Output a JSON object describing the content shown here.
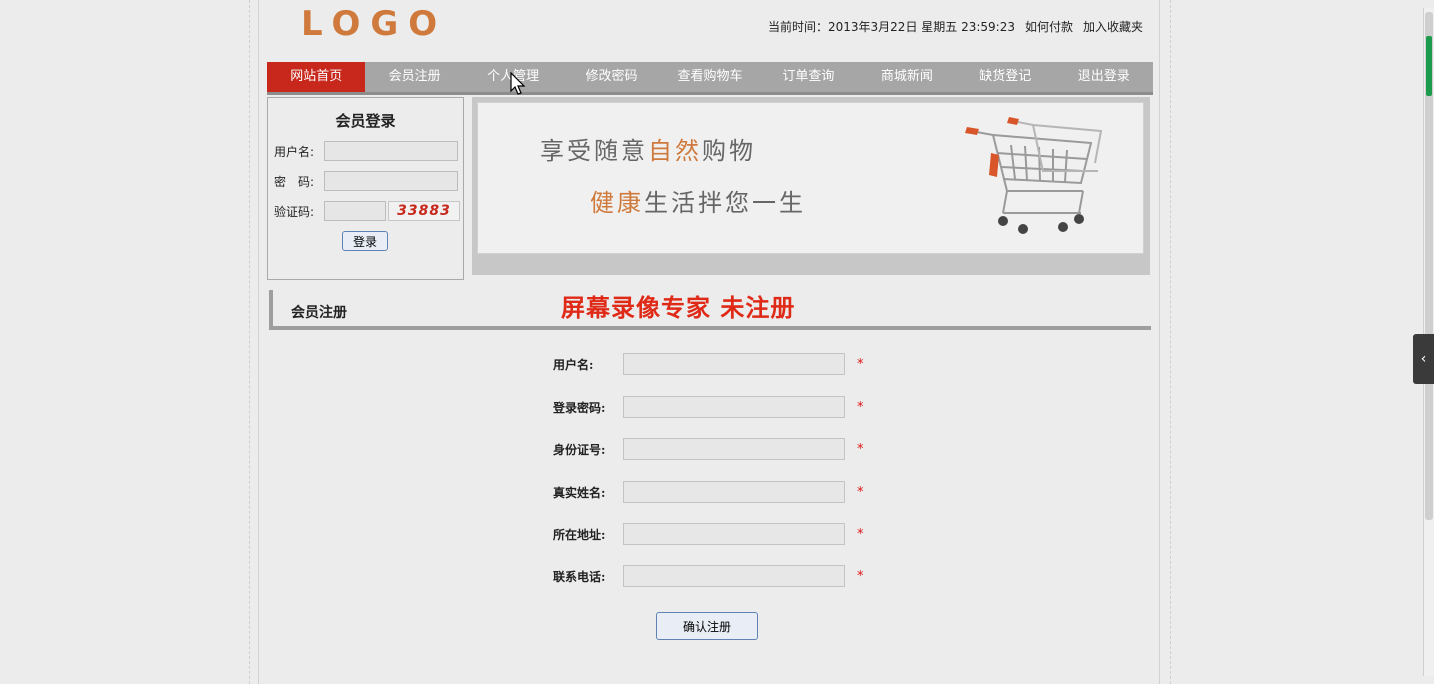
{
  "header": {
    "logo": "LOGO",
    "time_label": "当前时间：2013年3月22日 星期五 23:59:23",
    "link_payment": "如何付款",
    "link_favorite": "加入收藏夹"
  },
  "nav": {
    "items": [
      {
        "label": "网站首页"
      },
      {
        "label": "会员注册"
      },
      {
        "label": "个人管理"
      },
      {
        "label": "修改密码"
      },
      {
        "label": "查看购物车"
      },
      {
        "label": "订单查询"
      },
      {
        "label": "商城新闻"
      },
      {
        "label": "缺货登记"
      },
      {
        "label": "退出登录"
      }
    ]
  },
  "login": {
    "title": "会员登录",
    "username_label": "用户名:",
    "password_label": "密　码:",
    "captcha_label": "验证码:",
    "captcha_value": "33883",
    "login_button": "登录"
  },
  "banner": {
    "line1_a": "享受随意",
    "line1_b": "自然",
    "line1_c": "购物",
    "line2_a": "健康",
    "line2_b": "生活拌您一生"
  },
  "register": {
    "section_title": "会员注册",
    "watermark": "屏幕录像专家  未注册",
    "required_mark": "*",
    "fields": [
      {
        "label": "用户名:"
      },
      {
        "label": "登录密码:"
      },
      {
        "label": "身份证号:"
      },
      {
        "label": "真实姓名:"
      },
      {
        "label": "所在地址:"
      },
      {
        "label": "联系电话:"
      }
    ],
    "submit_button": "确认注册"
  },
  "colors": {
    "nav_active": "#c8281c",
    "nav_bg": "#a6a6a6",
    "accent": "#cf7a3c",
    "watermark": "#e02a18"
  },
  "icons": {
    "cart": "shopping-cart-icon",
    "cursor": "mouse-cursor-icon",
    "collapse": "chevron-left-icon"
  }
}
